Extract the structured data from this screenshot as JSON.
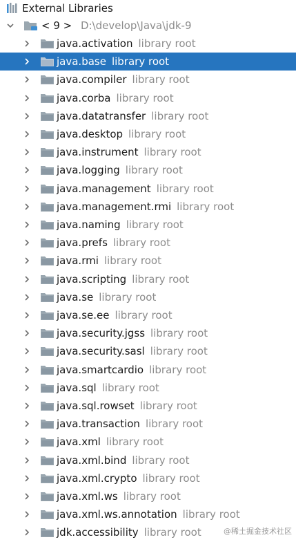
{
  "root": {
    "title": "External Libraries",
    "icon": "library-bars-icon"
  },
  "sdk": {
    "label": "< 9 >",
    "path": "D:\\develop\\Java\\jdk-9",
    "icon": "jdk-folder-icon"
  },
  "modules": [
    {
      "name": "java.activation",
      "hint": "library root",
      "selected": false
    },
    {
      "name": "java.base",
      "hint": "library root",
      "selected": true
    },
    {
      "name": "java.compiler",
      "hint": "library root",
      "selected": false
    },
    {
      "name": "java.corba",
      "hint": "library root",
      "selected": false
    },
    {
      "name": "java.datatransfer",
      "hint": "library root",
      "selected": false
    },
    {
      "name": "java.desktop",
      "hint": "library root",
      "selected": false
    },
    {
      "name": "java.instrument",
      "hint": "library root",
      "selected": false
    },
    {
      "name": "java.logging",
      "hint": "library root",
      "selected": false
    },
    {
      "name": "java.management",
      "hint": "library root",
      "selected": false
    },
    {
      "name": "java.management.rmi",
      "hint": "library root",
      "selected": false
    },
    {
      "name": "java.naming",
      "hint": "library root",
      "selected": false
    },
    {
      "name": "java.prefs",
      "hint": "library root",
      "selected": false
    },
    {
      "name": "java.rmi",
      "hint": "library root",
      "selected": false
    },
    {
      "name": "java.scripting",
      "hint": "library root",
      "selected": false
    },
    {
      "name": "java.se",
      "hint": "library root",
      "selected": false
    },
    {
      "name": "java.se.ee",
      "hint": "library root",
      "selected": false
    },
    {
      "name": "java.security.jgss",
      "hint": "library root",
      "selected": false
    },
    {
      "name": "java.security.sasl",
      "hint": "library root",
      "selected": false
    },
    {
      "name": "java.smartcardio",
      "hint": "library root",
      "selected": false
    },
    {
      "name": "java.sql",
      "hint": "library root",
      "selected": false
    },
    {
      "name": "java.sql.rowset",
      "hint": "library root",
      "selected": false
    },
    {
      "name": "java.transaction",
      "hint": "library root",
      "selected": false
    },
    {
      "name": "java.xml",
      "hint": "library root",
      "selected": false
    },
    {
      "name": "java.xml.bind",
      "hint": "library root",
      "selected": false
    },
    {
      "name": "java.xml.crypto",
      "hint": "library root",
      "selected": false
    },
    {
      "name": "java.xml.ws",
      "hint": "library root",
      "selected": false
    },
    {
      "name": "java.xml.ws.annotation",
      "hint": "library root",
      "selected": false
    },
    {
      "name": "jdk.accessibility",
      "hint": "library root",
      "selected": false
    }
  ],
  "watermark": "@稀土掘金技术社区",
  "colors": {
    "selection": "#2675bf",
    "hint": "#8c8c8c",
    "folder": "#9aa7b0"
  }
}
